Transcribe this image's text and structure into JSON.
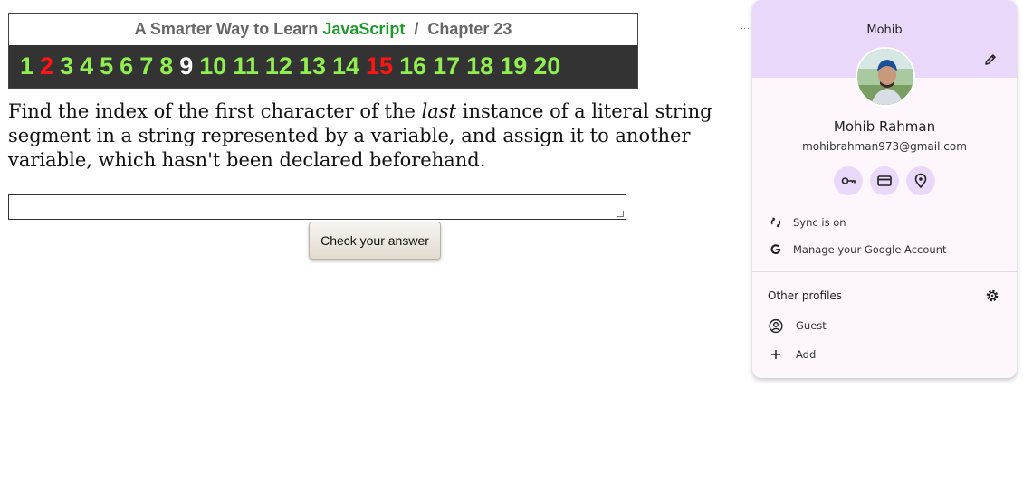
{
  "header": {
    "title_prefix": "A Smarter Way to Learn ",
    "title_brand": "JavaScript",
    "title_suffix": "  /  Chapter 23",
    "numbers": [
      {
        "label": "1",
        "state": "done"
      },
      {
        "label": "2",
        "state": "wrong"
      },
      {
        "label": "3",
        "state": "done"
      },
      {
        "label": "4",
        "state": "done"
      },
      {
        "label": "5",
        "state": "done"
      },
      {
        "label": "6",
        "state": "done"
      },
      {
        "label": "7",
        "state": "done"
      },
      {
        "label": "8",
        "state": "done"
      },
      {
        "label": "9",
        "state": "current"
      },
      {
        "label": "10",
        "state": "done"
      },
      {
        "label": "11",
        "state": "done"
      },
      {
        "label": "12",
        "state": "done"
      },
      {
        "label": "13",
        "state": "done"
      },
      {
        "label": "14",
        "state": "done"
      },
      {
        "label": "15",
        "state": "wrong"
      },
      {
        "label": "16",
        "state": "done"
      },
      {
        "label": "17",
        "state": "done"
      },
      {
        "label": "18",
        "state": "done"
      },
      {
        "label": "19",
        "state": "done"
      },
      {
        "label": "20",
        "state": "done"
      }
    ]
  },
  "question": {
    "before": "Find the index of the first character of the ",
    "emphasis": "last",
    "after": " instance of a literal string segment in a string represented by a variable, and assign it to another variable, which hasn't been declared beforehand."
  },
  "answer": {
    "value": ""
  },
  "check_button": {
    "label": "Check your answer"
  },
  "overflow_dots": "...",
  "profile": {
    "short_name": "Mohib",
    "full_name": "Mohib Rahman",
    "email": "mohibrahman973@gmail.com",
    "sync_label": "Sync is on",
    "manage_label": "Manage your Google Account",
    "other_profiles_label": "Other profiles",
    "guest_label": "Guest",
    "add_label": "Add"
  },
  "colors": {
    "done": "#90ee50",
    "wrong": "#ff1414",
    "current": "#ffffff",
    "brand": "#1a9c2a",
    "popup_accent": "#ead8fb"
  }
}
